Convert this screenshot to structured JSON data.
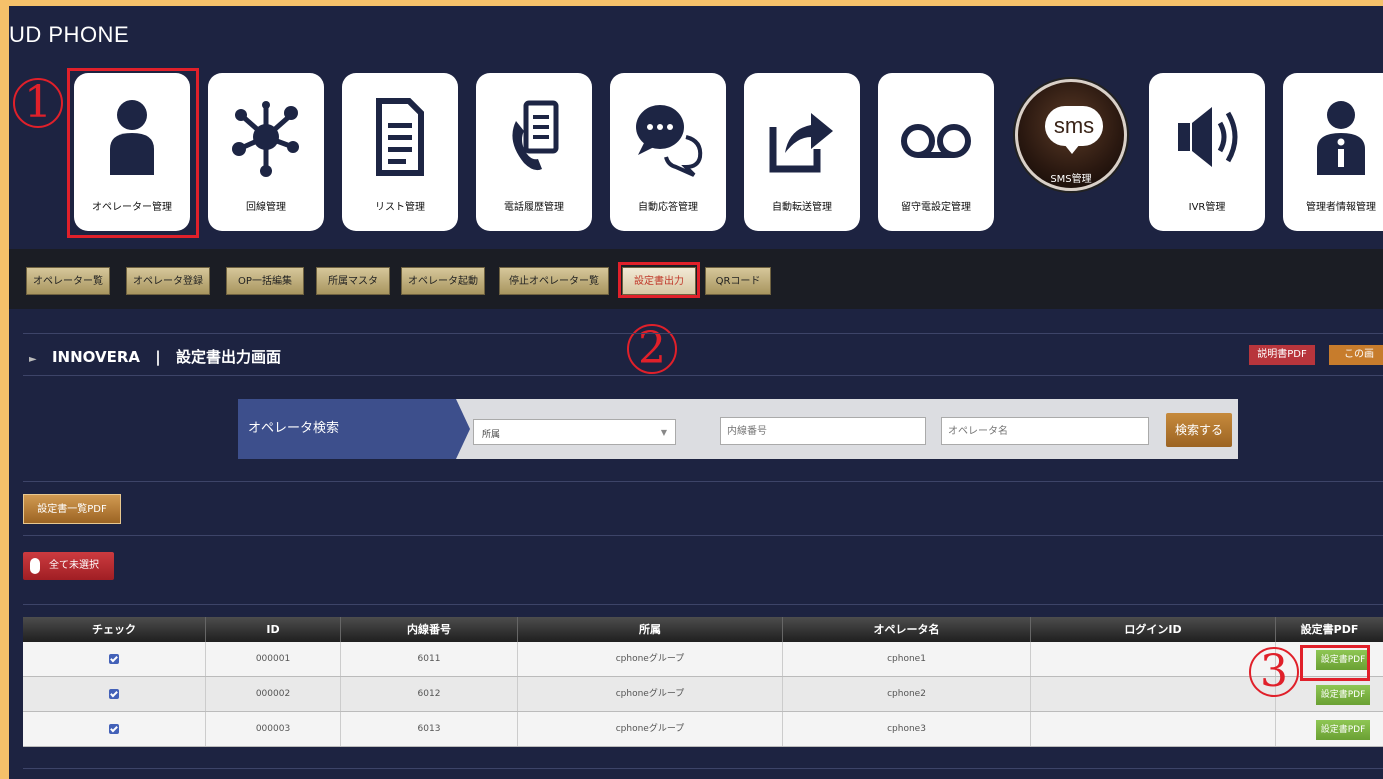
{
  "app": {
    "title": "UD PHONE"
  },
  "tiles": [
    {
      "label": "オペレーター管理",
      "icon": "user-icon"
    },
    {
      "label": "回線管理",
      "icon": "network-icon"
    },
    {
      "label": "リスト管理",
      "icon": "document-list-icon"
    },
    {
      "label": "電話履歴管理",
      "icon": "phone-log-icon"
    },
    {
      "label": "自動応答管理",
      "icon": "chat-bubbles-icon"
    },
    {
      "label": "自動転送管理",
      "icon": "forward-share-icon"
    },
    {
      "label": "留守電設定管理",
      "icon": "voicemail-icon"
    },
    {
      "label": "SMS管理",
      "icon": "sms-icon",
      "bubble": "sms"
    },
    {
      "label": "IVR管理",
      "icon": "speaker-icon"
    },
    {
      "label": "管理者情報管理",
      "icon": "admin-info-icon"
    }
  ],
  "subnav": [
    "オペレーター覧",
    "オペレータ登録",
    "OP一括編集",
    "所属マスタ",
    "オペレータ起動",
    "停止オペレーター覧",
    "設定書出力",
    "QRコード"
  ],
  "annotations": [
    "1",
    "2",
    "3"
  ],
  "section": {
    "company": "INNOVERA",
    "separator": "|",
    "page_title": "設定書出力画面",
    "manual_pdf": "説明書PDF",
    "this_page": "この画"
  },
  "search": {
    "label": "オペレータ検索",
    "affiliation_value": "所属",
    "extension_placeholder": "内線番号",
    "name_placeholder": "オペレータ名",
    "button": "検索する"
  },
  "actions": {
    "pdf_list": "設定書一覧PDF",
    "unselect_all": "全て未選択"
  },
  "table": {
    "headers": [
      "チェック",
      "ID",
      "内線番号",
      "所属",
      "オペレータ名",
      "ログインID",
      "設定書PDF"
    ],
    "pdf_button": "設定書PDF",
    "rows": [
      {
        "id": "000001",
        "ext": "6011",
        "group": "cphoneグループ",
        "name": "cphone1",
        "login": ""
      },
      {
        "id": "000002",
        "ext": "6012",
        "group": "cphoneグループ",
        "name": "cphone2",
        "login": ""
      },
      {
        "id": "000003",
        "ext": "6013",
        "group": "cphoneグループ",
        "name": "cphone3",
        "login": ""
      }
    ]
  },
  "colors": {
    "frame_bg": "#1d2341",
    "border_bg": "#f5c16a",
    "annotation": "#e0202a",
    "search_label": "#3d4f8c",
    "pdf_green": "#7bb543"
  }
}
